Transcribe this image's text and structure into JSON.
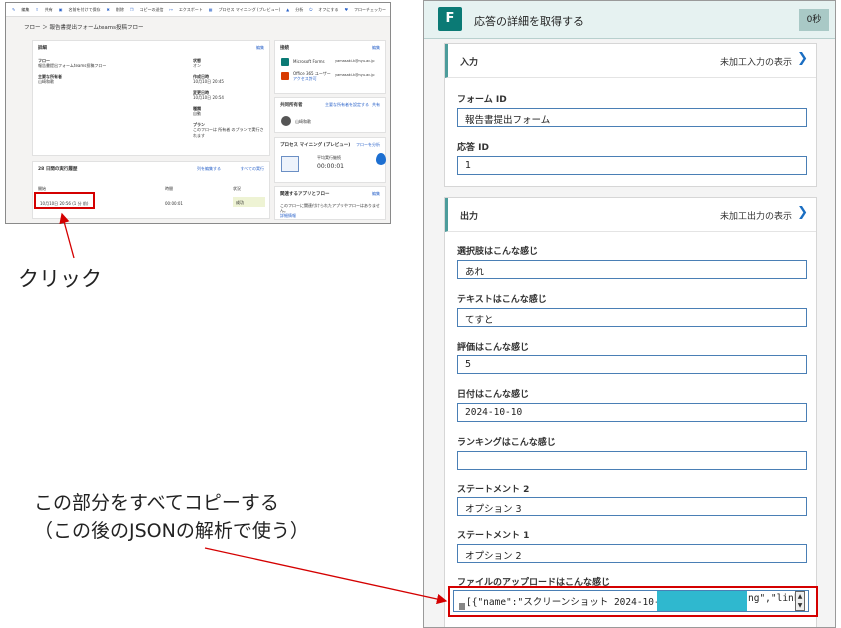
{
  "mini": {
    "toolbar": [
      "編集",
      "共有",
      "名前を付けて保存",
      "削除",
      "コピーの送信",
      "エクスポート",
      "プロセス マイニング (プレビュー)",
      "分析",
      "オフにする",
      "フローチェッカー"
    ],
    "breadcrumb": "フロー ＞ 報告書提出フォームteams投稿フロー",
    "details": {
      "title": "詳細",
      "edit": "編集",
      "flow_label": "フロー",
      "flow_value": "報告書提出フォームteams投稿フロー",
      "owner_label": "主要な所有者",
      "owner_value": "山崎和歌",
      "status_label": "状態",
      "status_value": "オン",
      "created_label": "作成日時",
      "created_value": "10月10日 20:45",
      "modified_label": "変更日時",
      "modified_value": "10月10日 20:54",
      "type_label": "種類",
      "type_value": "自動",
      "plan_label": "プラン",
      "plan_value": "このフローは 所有者 のプランで実行されます"
    },
    "connections": {
      "title": "接続",
      "edit": "編集",
      "items": [
        {
          "name": "Microsoft Forms",
          "account": "yamasaki-k@nyu.ac.jp"
        },
        {
          "name": "Office 365 ユーザー",
          "sub": "アクセス許可",
          "account": "yamasaki-k@nyu.ac.jp"
        }
      ]
    },
    "coowners": {
      "title": "共同所有者",
      "action": "主要な所有者を設定する",
      "share": "共有",
      "person": "山崎和歌"
    },
    "process": {
      "title": "プロセス マイニング (プレビュー)",
      "action": "フローを分析",
      "avg_label": "平均実行継続",
      "avg_value": "00:00:01"
    },
    "related": {
      "title": "関連するアプリとフロー",
      "edit": "編集",
      "body": "このフローに関連付けられたアプリやフローはありません。",
      "link": "詳細情報"
    },
    "runs": {
      "title": "28 日間の実行履歴",
      "edit_cols": "列を編集する",
      "view_all": "すべての実行",
      "headers": [
        "開始",
        "時間",
        "状況"
      ],
      "row": {
        "start": "10月10日 20:56 (1 分 前)",
        "duration": "00:00:01",
        "status": "成功"
      }
    }
  },
  "annotations": {
    "click": "クリック",
    "copy_line1": "この部分をすべてコピーする",
    "copy_line2": "（この後のJSONの解析で使う）"
  },
  "panel": {
    "title": "応答の詳細を取得する",
    "badge": "0秒",
    "input_section": {
      "title": "入力",
      "link": "未加工入力の表示",
      "fields": [
        {
          "label": "フォーム ID",
          "value": "報告書提出フォーム"
        },
        {
          "label": "応答 ID",
          "value": "1"
        }
      ]
    },
    "output_section": {
      "title": "出力",
      "link": "未加工出力の表示",
      "fields": [
        {
          "label": "選択肢はこんな感じ",
          "value": "あれ"
        },
        {
          "label": "テキストはこんな感じ",
          "value": "てすと"
        },
        {
          "label": "評価はこんな感じ",
          "value": "5"
        },
        {
          "label": "日付はこんな感じ",
          "value": "2024-10-10"
        },
        {
          "label": "ランキングはこんな感じ",
          "value": ""
        },
        {
          "label": "ステートメント 2",
          "value": "オプション 3"
        },
        {
          "label": "ステートメント 1",
          "value": "オプション 2"
        },
        {
          "label": "ファイルのアップロードはこんな感じ",
          "value": "[{\"name\":\"スクリーンショット 2024-10-10"
        },
        {
          "value": "ng\",\"link"
        }
      ]
    }
  },
  "icons": {
    "forms": "forms-app-icon",
    "chevron": "chevron-right-icon"
  },
  "colors": {
    "accent": "#4c9c9b",
    "header_bg": "#e6f2f1",
    "highlight": "#d40000",
    "redact": "#2fb8cf",
    "field_border": "#4a7fb5"
  }
}
